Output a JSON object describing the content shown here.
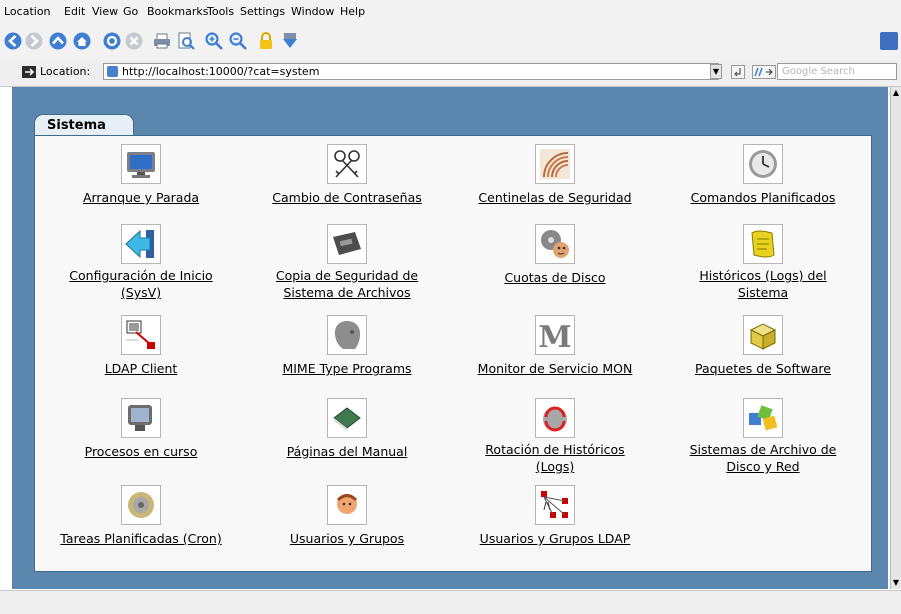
{
  "menu": [
    "Location",
    "Edit",
    "View",
    "Go",
    "Bookmarks",
    "Tools",
    "Settings",
    "Window",
    "Help"
  ],
  "toolbar_icons": [
    "back-icon",
    "forward-icon",
    "up-icon",
    "home-icon",
    "reload-icon",
    "stop-icon",
    "print-icon",
    "print-preview-icon",
    "zoom-in-icon",
    "zoom-out-icon",
    "security-lock-icon",
    "bookmark-icon"
  ],
  "location": {
    "label": "Location:",
    "url": "http://localhost:10000/?cat=system",
    "search_placeholder": "Google Search"
  },
  "category": {
    "title": "Sistema"
  },
  "items": [
    {
      "label": "Arranque y Parada",
      "icon": "monitor-icon"
    },
    {
      "label": "Cambio de Contraseñas",
      "icon": "keys-icon"
    },
    {
      "label": "Centinelas de Seguridad",
      "icon": "security-sentinel-icon"
    },
    {
      "label": "Comandos Planificados",
      "icon": "clock-icon"
    },
    {
      "label": "Configuración de Inicio (SysV)",
      "icon": "arrow-left-icon"
    },
    {
      "label": "Copia de Seguridad de Sistema de Archivos",
      "icon": "tape-backup-icon"
    },
    {
      "label": "Cuotas de Disco",
      "icon": "disk-quota-icon"
    },
    {
      "label": "Históricos (Logs) del Sistema",
      "icon": "scroll-log-icon"
    },
    {
      "label": "LDAP Client",
      "icon": "ldap-client-icon"
    },
    {
      "label": "MIME Type Programs",
      "icon": "mime-head-icon"
    },
    {
      "label": "Monitor de Servicio MON",
      "icon": "mon-letter-icon"
    },
    {
      "label": "Paquetes de Software",
      "icon": "package-box-icon"
    },
    {
      "label": "Procesos en curso",
      "icon": "process-monitor-icon"
    },
    {
      "label": "Páginas del Manual",
      "icon": "manual-book-icon"
    },
    {
      "label": "Rotación de Históricos (Logs)",
      "icon": "log-rotation-icon"
    },
    {
      "label": "Sistemas de Archivo de Disco y Red",
      "icon": "filesystem-shapes-icon"
    },
    {
      "label": "Tareas Planificadas (Cron)",
      "icon": "cron-coins-icon"
    },
    {
      "label": "Usuarios y Grupos",
      "icon": "users-groups-icon"
    },
    {
      "label": "Usuarios y Grupos LDAP",
      "icon": "ldap-users-icon"
    }
  ],
  "colors": {
    "page_background": "#5b86ad",
    "panel": "#f8f8f8",
    "tab": "#e6eef6"
  }
}
